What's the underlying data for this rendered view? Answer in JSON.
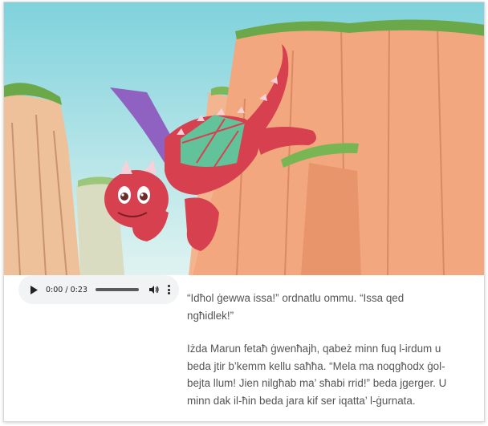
{
  "illustration": {
    "alt_icon": "dragon-canyon-illustration",
    "colors": {
      "sky": "#b8e4ec",
      "cliff": "#f0a07a",
      "dragon": "#d7414f",
      "wing_purple": "#8f62c1",
      "wing_green": "#62c39a",
      "grass": "#6aa84a"
    }
  },
  "audio_player": {
    "current_time": "0:00",
    "separator": " / ",
    "duration": "0:23",
    "progress": 0.0,
    "play_icon": "play-icon",
    "volume_icon": "volume-icon",
    "menu_icon": "more-vert-icon"
  },
  "story": {
    "paragraphs": [
      "“Idħol ġewwa issa!” ordnatlu ommu. “Issa qed ngħidlek!”",
      "Iżda Marun fetaħ ġwenħajh, qabeż minn fuq l-irdum u beda jtir b’kemm kellu saħħa. “Mela ma noqgħodx ġol-bejta llum! Jien nilgħab ma’ sħabi rrid!” beda jgerger. U minn dak il-ħin beda jara kif ser iqatta’ l-ġurnata."
    ]
  }
}
